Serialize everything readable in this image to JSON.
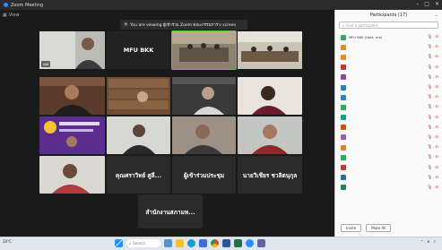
{
  "window": {
    "title": "Zoom Meeting",
    "controls": [
      "–",
      "□",
      "✕"
    ]
  },
  "meeting": {
    "view_label": "View",
    "banner_text": "You are viewing ผู้เข้าร่วม Zoom คณะกรรมการ's screen"
  },
  "tiles": [
    {
      "name": "คุณ",
      "big": ""
    },
    {
      "name": "",
      "big": "MFU BKK"
    },
    {
      "name": "",
      "big": ""
    },
    {
      "name": "",
      "big": ""
    },
    {
      "name": "",
      "big": ""
    },
    {
      "name": "",
      "big": ""
    },
    {
      "name": "",
      "big": ""
    },
    {
      "name": "",
      "big": ""
    },
    {
      "name": "",
      "big": ""
    },
    {
      "name": "",
      "big": ""
    },
    {
      "name": "",
      "big": ""
    },
    {
      "name": "",
      "big": ""
    },
    {
      "name": "",
      "big": ""
    },
    {
      "name": "",
      "big": ""
    },
    {
      "name": "",
      "big": "คุณศราวิทย์ ศูลี..."
    },
    {
      "name": "",
      "big": "ผู้เข้าร่วมประชุม"
    },
    {
      "name": "",
      "big": "นายวิเชียร ชวลิตนุกุล"
    },
    {
      "name": "",
      "big": "สำนักงานสภามห..."
    }
  ],
  "participants": {
    "header": "Participants (17)",
    "search_placeholder": "Find a participant",
    "items": [
      {
        "name": "MFU BKK (Host, me)",
        "color": "#3aa55c",
        "mic": "on",
        "cam": "off"
      },
      {
        "name": "",
        "color": "#e08b2d",
        "mic": "off",
        "cam": "off"
      },
      {
        "name": "",
        "color": "#e08b2d",
        "mic": "on",
        "cam": "off"
      },
      {
        "name": "",
        "color": "#c0392b",
        "mic": "off",
        "cam": "off"
      },
      {
        "name": "",
        "color": "#8e44ad",
        "mic": "off",
        "cam": "off"
      },
      {
        "name": "",
        "color": "#2980b9",
        "mic": "off",
        "cam": "off"
      },
      {
        "name": "",
        "color": "#2e86c1",
        "mic": "off",
        "cam": "off"
      },
      {
        "name": "",
        "color": "#27ae60",
        "mic": "off",
        "cam": "off"
      },
      {
        "name": "",
        "color": "#16a085",
        "mic": "off",
        "cam": "off"
      },
      {
        "name": "",
        "color": "#d35400",
        "mic": "off",
        "cam": "off"
      },
      {
        "name": "",
        "color": "#9b59b6",
        "mic": "off",
        "cam": "off"
      },
      {
        "name": "",
        "color": "#e67e22",
        "mic": "off",
        "cam": "off"
      },
      {
        "name": "",
        "color": "#27ae60",
        "mic": "off",
        "cam": "off"
      },
      {
        "name": "",
        "color": "#c0392b",
        "mic": "off",
        "cam": "off"
      },
      {
        "name": "",
        "color": "#2471a3",
        "mic": "off",
        "cam": "off"
      },
      {
        "name": "",
        "color": "#1e8449",
        "mic": "off",
        "cam": "off"
      }
    ],
    "invite_label": "Invite",
    "mute_all_label": "Mute All"
  },
  "taskbar": {
    "weather_temp": "28°C",
    "weather_desc": "",
    "search_label": "Search",
    "time": "",
    "date": ""
  }
}
